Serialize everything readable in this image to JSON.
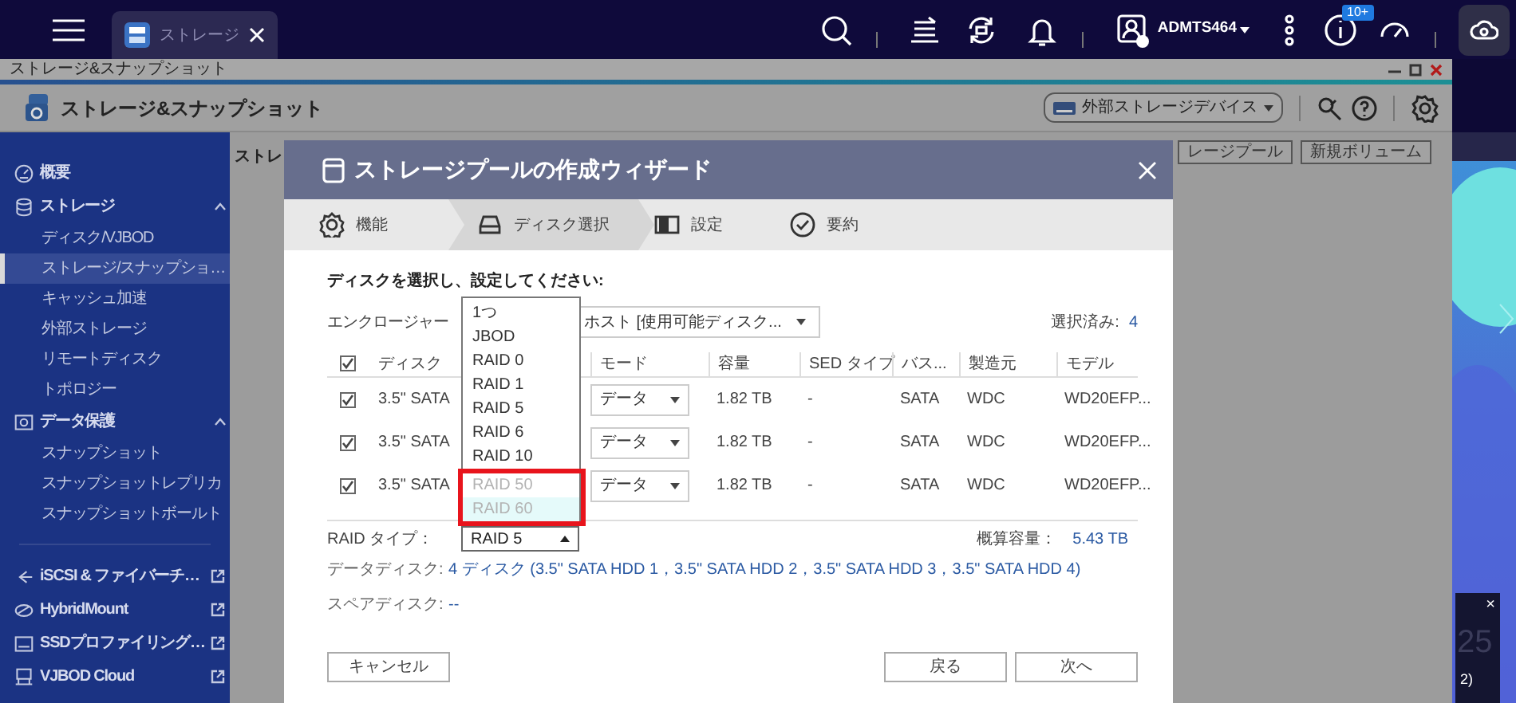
{
  "top_bar": {
    "tab": {
      "title": "ストレージ"
    },
    "user": "ADMTS464",
    "notification_badge": "10+"
  },
  "app_window": {
    "title": "ストレージ&スナップショット",
    "header_title": "ストレージ&スナップショット",
    "device_menu": "外部ストレージデバイス"
  },
  "sidebar": {
    "items": [
      {
        "label": "概要",
        "kind": "page",
        "selected": false
      },
      {
        "label": "ストレージ",
        "kind": "section",
        "selected": false,
        "expanded": true,
        "children": [
          {
            "label": "ディスク/VJBOD",
            "selected": false
          },
          {
            "label": "ストレージ/スナップショ…",
            "selected": true
          },
          {
            "label": "キャッシュ加速",
            "selected": false
          },
          {
            "label": "外部ストレージ",
            "selected": false
          },
          {
            "label": "リモートディスク",
            "selected": false
          },
          {
            "label": "トポロジー",
            "selected": false
          }
        ]
      },
      {
        "label": "データ保護",
        "kind": "section",
        "selected": false,
        "expanded": true,
        "children": [
          {
            "label": "スナップショット",
            "selected": false
          },
          {
            "label": "スナップショットレプリカ",
            "selected": false
          },
          {
            "label": "スナップショットボールト",
            "selected": false
          }
        ]
      },
      {
        "label": "iSCSI & ファイバーチ…",
        "kind": "external",
        "selected": false
      },
      {
        "label": "HybridMount",
        "kind": "external",
        "selected": false
      },
      {
        "label": "SSDプロファイリング…",
        "kind": "external",
        "selected": false
      },
      {
        "label": "VJBOD Cloud",
        "kind": "external",
        "selected": false
      }
    ]
  },
  "main": {
    "title": "ストレ",
    "buttons": [
      "レージプール",
      "新規ボリューム"
    ]
  },
  "wizard": {
    "title": "ストレージプールの作成ウィザード",
    "steps": [
      {
        "label": "機能",
        "selected": false
      },
      {
        "label": "ディスク選択",
        "selected": true
      },
      {
        "label": "設定",
        "selected": false
      },
      {
        "label": "要約",
        "selected": false
      }
    ],
    "instruction": "ディスクを選択し、設定してください:",
    "enclosure": {
      "label": "エンクロージャー",
      "value": "ホスト [使用可能ディスク..."
    },
    "selected_count": {
      "label": "選択済み:",
      "value": "4"
    },
    "table": {
      "select_all_checked": true,
      "columns": [
        "ディスク",
        "モード",
        "容量",
        "SED タイプ",
        "バス...",
        "製造元",
        "モデル"
      ],
      "rows": [
        {
          "checked": true,
          "disk": "3.5\" SATA",
          "mode": "データ",
          "capacity": "1.82 TB",
          "sed_type": "-",
          "bus": "SATA",
          "manufacturer": "WDC",
          "model": "WD20EFP..."
        },
        {
          "checked": true,
          "disk": "3.5\" SATA",
          "mode": "データ",
          "capacity": "1.82 TB",
          "sed_type": "-",
          "bus": "SATA",
          "manufacturer": "WDC",
          "model": "WD20EFP..."
        },
        {
          "checked": true,
          "disk": "3.5\" SATA",
          "mode": "データ",
          "capacity": "1.82 TB",
          "sed_type": "-",
          "bus": "SATA",
          "manufacturer": "WDC",
          "model": "WD20EFP..."
        }
      ]
    },
    "raid_type": {
      "label": "RAID タイプ：",
      "value": "RAID 5",
      "expanded": true,
      "options": [
        {
          "label": "1つ",
          "disabled": false,
          "highlighted": false,
          "annotated": false
        },
        {
          "label": "JBOD",
          "disabled": false,
          "highlighted": false,
          "annotated": false
        },
        {
          "label": "RAID 0",
          "disabled": false,
          "highlighted": false,
          "annotated": false
        },
        {
          "label": "RAID 1",
          "disabled": false,
          "highlighted": false,
          "annotated": false
        },
        {
          "label": "RAID 5",
          "disabled": false,
          "highlighted": false,
          "annotated": false
        },
        {
          "label": "RAID 6",
          "disabled": false,
          "highlighted": false,
          "annotated": false
        },
        {
          "label": "RAID 10",
          "disabled": false,
          "highlighted": false,
          "annotated": false
        },
        {
          "label": "RAID 50",
          "disabled": true,
          "highlighted": false,
          "annotated": true
        },
        {
          "label": "RAID 60",
          "disabled": true,
          "highlighted": true,
          "annotated": true
        }
      ]
    },
    "capacity": {
      "label": "概算容量：",
      "value": "5.43 TB"
    },
    "data_disks": {
      "label": "データディスク:",
      "value": "4 ディスク (3.5\" SATA HDD 1，3.5\" SATA HDD 2，3.5\" SATA HDD 3，3.5\" SATA HDD 4)"
    },
    "spare_disks": {
      "label": "スペアディスク:",
      "value": "--"
    },
    "buttons": {
      "cancel": "キャンセル",
      "back": "戻る",
      "next": "次へ"
    }
  },
  "desktop_widget": {
    "close": "×",
    "number": "25",
    "note": "2)"
  }
}
